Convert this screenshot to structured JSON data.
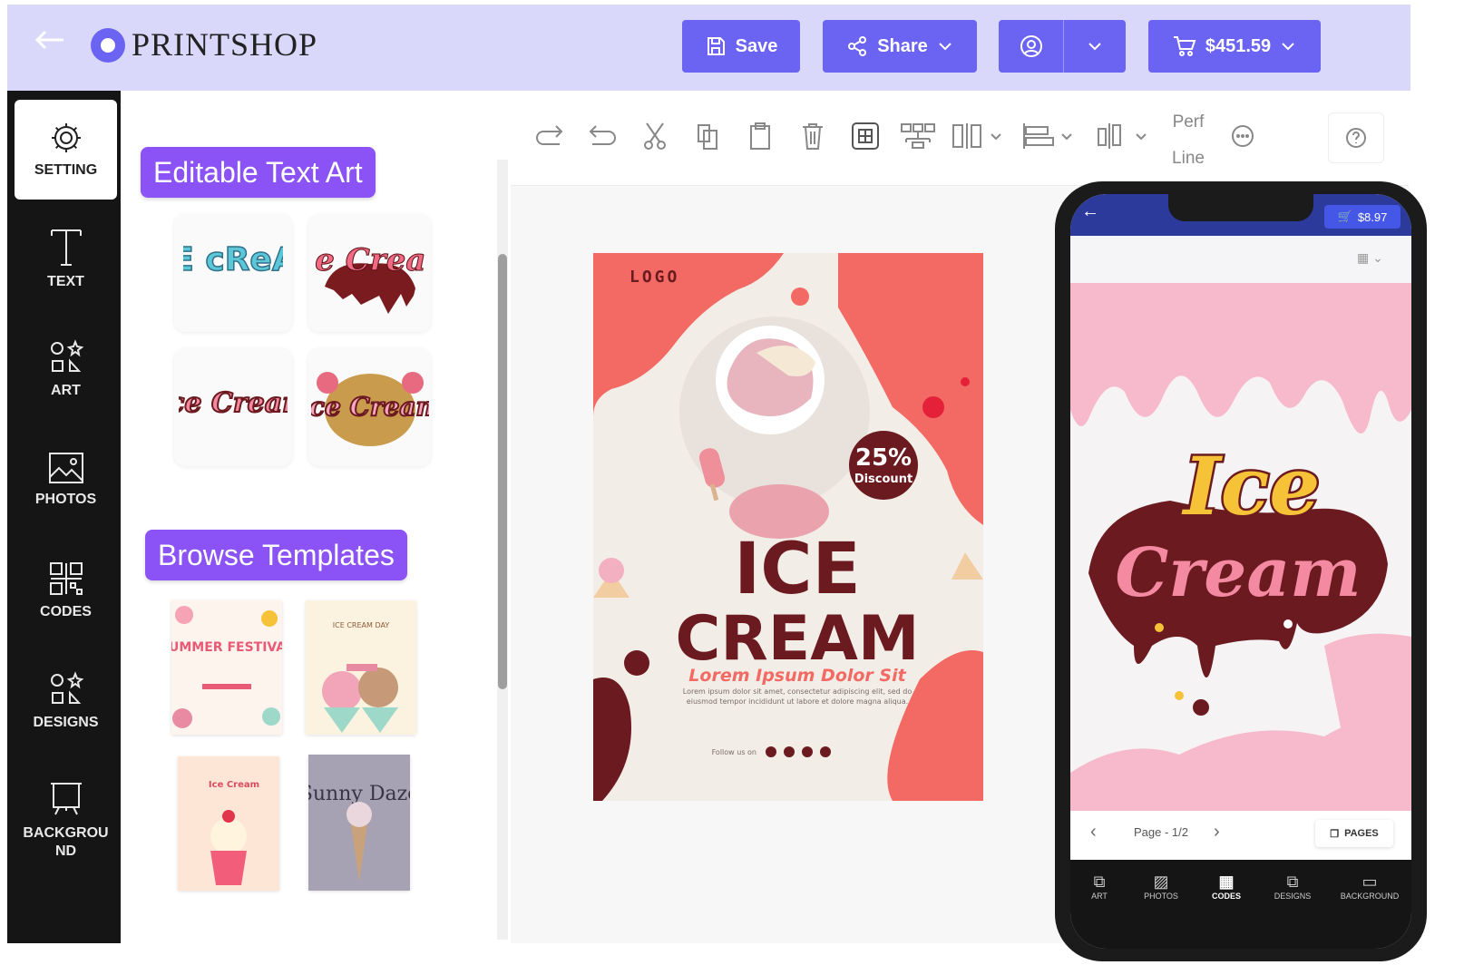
{
  "header": {
    "app_name": "PRINTSHOP",
    "save_label": "Save",
    "share_label": "Share",
    "cart_total": "$451.59"
  },
  "rail": {
    "items": [
      {
        "label": "SETTING",
        "icon": "gear-icon"
      },
      {
        "label": "TEXT",
        "icon": "text-icon"
      },
      {
        "label": "ART",
        "icon": "art-icon"
      },
      {
        "label": "PHOTOS",
        "icon": "photo-icon"
      },
      {
        "label": "CODES",
        "icon": "qr-code-icon"
      },
      {
        "label": "DESIGNS",
        "icon": "designs-icon"
      },
      {
        "label": "BACKGROU ND",
        "icon": "background-icon"
      }
    ]
  },
  "panel": {
    "text_art_title": "Editable Text Art",
    "templates_title": "Browse Templates",
    "text_art": [
      "iCE cReAM",
      "Ice Cream",
      "Ice Cream",
      "Ice Cream"
    ],
    "templates": [
      {
        "title": "SUMMER FESTIVAL"
      },
      {
        "title": "ICE CREAM DAY"
      },
      {
        "title": "Ice Cream"
      },
      {
        "title": "Sunny Daze"
      }
    ]
  },
  "toolbar": {
    "perf_line_label_1": "Perf",
    "perf_line_label_2": "Line"
  },
  "poster": {
    "logo": "LOGO",
    "discount_value": "25%",
    "discount_label": "Discount",
    "title_line1": "ICE",
    "title_line2": "CREAM",
    "subtitle": "Lorem Ipsum Dolor Sit",
    "body": "Lorem ipsum dolor sit amet, consectetur adipiscing elit, sed do eiusmod tempor incididunt ut labore et dolore magna aliqua.",
    "follow": "Follow us on"
  },
  "phone": {
    "cart_total": "$8.97",
    "art_line1": "Ice",
    "art_line2": "Cream",
    "page_indicator": "Page - 1/2",
    "pages_label": "PAGES",
    "nav": [
      "ART",
      "PHOTOS",
      "CODES",
      "DESIGNS",
      "BACKGROUND"
    ]
  },
  "colors": {
    "accent": "#6b63f2",
    "section_purple": "#8b52f6",
    "header_bg": "#d9d8fb",
    "poster_red": "#f26a63",
    "maroon": "#6b1a1f",
    "pink": "#f7b9cc",
    "yellow": "#f6c237"
  }
}
